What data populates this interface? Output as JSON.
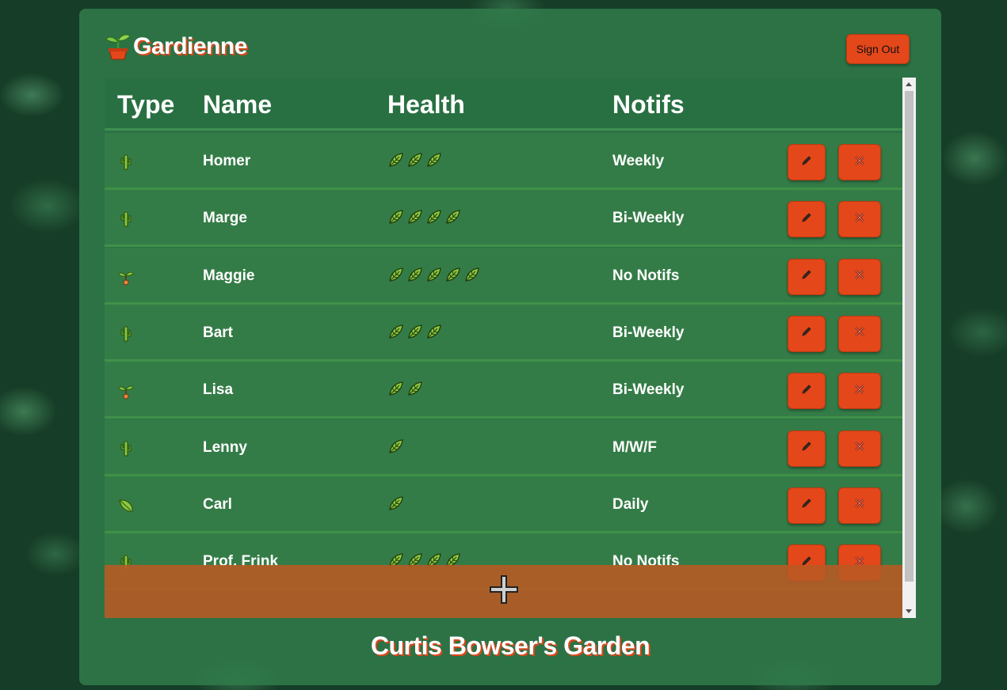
{
  "app": {
    "title": "Gardienne",
    "logo_icon": "potted-plant-icon",
    "sign_out_label": "Sign Out"
  },
  "table": {
    "headers": [
      "Type",
      "Name",
      "Health",
      "Notifs"
    ],
    "rows": [
      {
        "type_icon": "cactus-icon",
        "name": "Homer",
        "health": 3,
        "notifs": "Weekly"
      },
      {
        "type_icon": "cactus-icon",
        "name": "Marge",
        "health": 4,
        "notifs": "Bi-Weekly"
      },
      {
        "type_icon": "seedling-icon",
        "name": "Maggie",
        "health": 5,
        "notifs": "No Notifs"
      },
      {
        "type_icon": "cactus-icon",
        "name": "Bart",
        "health": 3,
        "notifs": "Bi-Weekly"
      },
      {
        "type_icon": "seedling-icon",
        "name": "Lisa",
        "health": 2,
        "notifs": "Bi-Weekly"
      },
      {
        "type_icon": "cactus-icon",
        "name": "Lenny",
        "health": 1,
        "notifs": "M/W/F"
      },
      {
        "type_icon": "leaf-icon",
        "name": "Carl",
        "health": 1,
        "notifs": "Daily"
      },
      {
        "type_icon": "cactus-icon",
        "name": "Prof. Frink",
        "health": 4,
        "notifs": "No Notifs"
      }
    ],
    "health_icon": "herb-leaf-icon",
    "edit_icon": "pencil-icon",
    "delete_icon": "cross-mark-icon",
    "add_icon": "plus-icon"
  },
  "footer": {
    "garden_title": "Curtis Bowser's Garden"
  },
  "colors": {
    "accent": "#e4471a",
    "panel": "#307a4a",
    "add_bar": "#ba5a24"
  }
}
